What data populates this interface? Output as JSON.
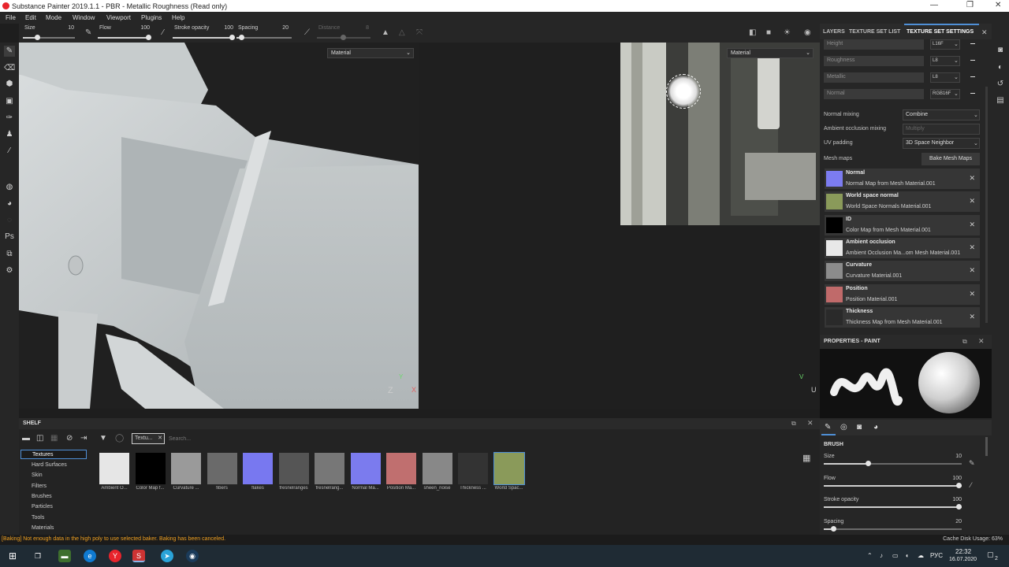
{
  "window": {
    "title": "Substance Painter 2019.1.1 - PBR - Metallic Roughness (Read only)"
  },
  "menu": [
    "File",
    "Edit",
    "Mode",
    "Window",
    "Viewport",
    "Plugins",
    "Help"
  ],
  "toolbar": {
    "size_label": "Size",
    "size_value": "10",
    "size_level": 0.25,
    "flow_label": "Flow",
    "flow_value": "100",
    "flow_level": 1.0,
    "opacity_label": "Stroke opacity",
    "opacity_value": "100",
    "opacity_level": 1.0,
    "spacing_label": "Spacing",
    "spacing_value": "20",
    "spacing_level": 0.05,
    "distance_label": "Distance",
    "distance_value": "8"
  },
  "viewport3d": {
    "channel_select": "Material",
    "axis_y": "Y",
    "axis_z": "Z",
    "axis_x": "X"
  },
  "viewport2d": {
    "channel_select": "Material",
    "axis_v": "V",
    "axis_u": "U"
  },
  "right_tabs": {
    "layers": "LAYERS",
    "texture_set_list": "TEXTURE SET LIST",
    "texture_set_settings": "TEXTURE SET SETTINGS"
  },
  "channels": [
    {
      "name": "Height",
      "format": "L16F"
    },
    {
      "name": "Roughness",
      "format": "L8"
    },
    {
      "name": "Metallic",
      "format": "L8"
    },
    {
      "name": "Normal",
      "format": "RGB16F"
    }
  ],
  "settings": {
    "normal_mixing_label": "Normal mixing",
    "normal_mixing_value": "Combine",
    "ao_mixing_label": "Ambient occlusion mixing",
    "ao_mixing_value": "Multiply",
    "uv_padding_label": "UV padding",
    "uv_padding_value": "3D Space Neighbor",
    "mesh_maps_label": "Mesh maps",
    "bake_button": "Bake Mesh Maps"
  },
  "mesh_maps": [
    {
      "title": "Normal",
      "subtitle": "Normal Map from Mesh Material.001",
      "color": "#7c7cf0"
    },
    {
      "title": "World space normal",
      "subtitle": "World Space Normals Material.001",
      "color": "#8a9a5a"
    },
    {
      "title": "ID",
      "subtitle": "Color Map from Mesh Material.001",
      "color": "#000000"
    },
    {
      "title": "Ambient occlusion",
      "subtitle": "Ambient Occlusion Ma...om Mesh Material.001",
      "color": "#e8e8e8"
    },
    {
      "title": "Curvature",
      "subtitle": "Curvature Material.001",
      "color": "#8c8c8c"
    },
    {
      "title": "Position",
      "subtitle": "Position Material.001",
      "color": "#c06a6a"
    },
    {
      "title": "Thickness",
      "subtitle": "Thickness Map from Mesh Material.001",
      "color": "#2a2a2a"
    }
  ],
  "properties": {
    "title": "PROPERTIES - PAINT",
    "brush_header": "BRUSH",
    "sliders": [
      {
        "label": "Size",
        "value": "10",
        "level": 0.3
      },
      {
        "label": "Flow",
        "value": "100",
        "level": 1.0
      },
      {
        "label": "Stroke opacity",
        "value": "100",
        "level": 1.0
      },
      {
        "label": "Spacing",
        "value": "20",
        "level": 0.05
      }
    ]
  },
  "shelf": {
    "title": "SHELF",
    "filter_tag": "Textu...",
    "search_placeholder": "Search...",
    "categories": [
      "Textures",
      "Hard Surfaces",
      "Skin",
      "Filters",
      "Brushes",
      "Particles",
      "Tools",
      "Materials"
    ],
    "selected_category": "Textures",
    "items": [
      {
        "label": "Ambient O...",
        "color": "#e6e6e6"
      },
      {
        "label": "Color Map f...",
        "color": "#000000"
      },
      {
        "label": "Curvature ...",
        "color": "#9a9a9a"
      },
      {
        "label": "fibers",
        "color": "#6a6a6a"
      },
      {
        "label": "flakes",
        "color": "#7878f0"
      },
      {
        "label": "fresnelranges",
        "color": "#555555"
      },
      {
        "label": "fresnelrang...",
        "color": "#777777"
      },
      {
        "label": "Normal Ma...",
        "color": "#7b7bee"
      },
      {
        "label": "Position Ma...",
        "color": "#c06f6f"
      },
      {
        "label": "sheen_noise",
        "color": "#888888"
      },
      {
        "label": "Thickness ...",
        "color": "#333333"
      },
      {
        "label": "World Spac...",
        "color": "#8a9a5a"
      }
    ]
  },
  "status": {
    "message": "[Baking] Not enough data in the high poly to use selected baker. Baking has been canceled.",
    "cache": "Cache Disk Usage:   63%"
  },
  "taskbar": {
    "lang": "РУС",
    "time": "22:32",
    "date": "16.07.2020",
    "notif": "2"
  }
}
